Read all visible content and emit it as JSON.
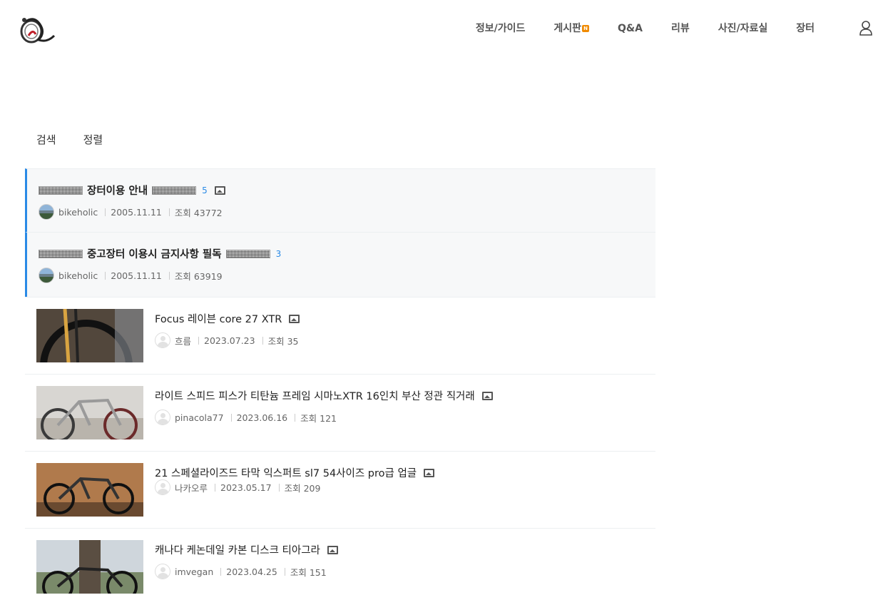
{
  "nav": {
    "items": [
      "정보/가이드",
      "게시판",
      "Q&A",
      "리뷰",
      "사진/자료실",
      "장터"
    ],
    "new_badge": "N"
  },
  "toolbar": {
    "search": "검색",
    "sort": "정렬"
  },
  "notices": [
    {
      "title": "장터이용 안내",
      "comments": "5",
      "author": "bikeholic",
      "date": "2005.11.11",
      "views": "조회 43772",
      "has_image": true
    },
    {
      "title": "중고장터 이용시 금지사항 필독",
      "comments": "3",
      "author": "bikeholic",
      "date": "2005.11.11",
      "views": "조회 63919",
      "has_image": false
    }
  ],
  "posts": [
    {
      "title": "Focus 레이븐 core 27 XTR",
      "author": "흐름",
      "date": "2023.07.23",
      "views": "조회 35"
    },
    {
      "title": "라이트 스피드 피스가 티탄늄 프레임 시마노XTR 16인치 부산 정관 직거래",
      "author": "pinacola77",
      "date": "2023.06.16",
      "views": "조회 121"
    },
    {
      "title": "21 스페셜라이즈드 타막 익스퍼트 sl7 54사이즈 pro급 업글",
      "author": "나카오루",
      "date": "2023.05.17",
      "views": "조회 209"
    },
    {
      "title": "캐나다 케논데일 카본 디스크 티아그라",
      "author": "imvegan",
      "date": "2023.04.25",
      "views": "조회 151"
    }
  ],
  "colors": {
    "accent": "#2a8ae6",
    "badge": "#f08a00",
    "notice_bg": "#f7f8f9"
  }
}
